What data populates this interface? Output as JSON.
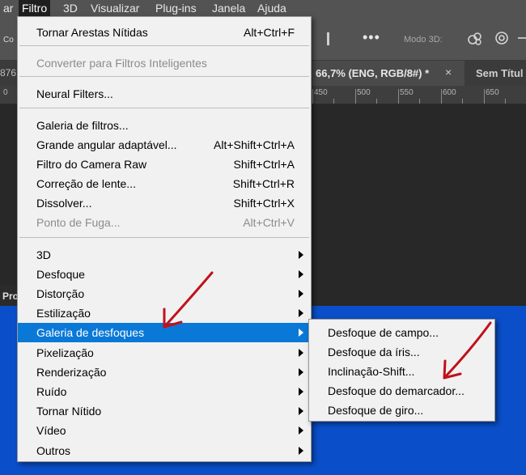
{
  "menubar": {
    "items": [
      {
        "label": "ar"
      },
      {
        "label": "Filtro"
      },
      {
        "label": "3D"
      },
      {
        "label": "Visualizar"
      },
      {
        "label": "Plug-ins"
      },
      {
        "label": "Janela"
      },
      {
        "label": "Ajuda"
      }
    ],
    "active_index": 1
  },
  "options_bar": {
    "left_label": "Co",
    "more_label": "•••",
    "mode3d_label": "Modo 3D:"
  },
  "tabs": {
    "left_number": "876",
    "active": {
      "label": "66,7% (ENG, RGB/8#) *",
      "close": "×"
    },
    "other": {
      "label": "Sem Títul"
    }
  },
  "ruler": {
    "labels": [
      "0",
      "450",
      "500",
      "550",
      "600",
      "650"
    ]
  },
  "panel": {
    "left_label": "Pro"
  },
  "filter_menu": {
    "items": [
      {
        "label": "Tornar Arestas Nítidas",
        "shortcut": "Alt+Ctrl+F",
        "disabled": false
      },
      {
        "label": "Converter para Filtros Inteligentes",
        "shortcut": "",
        "disabled": true
      },
      {
        "label": "Neural Filters...",
        "shortcut": "",
        "disabled": false
      },
      {
        "label": "Galeria de filtros...",
        "shortcut": "",
        "disabled": false
      },
      {
        "label": "Grande angular adaptável...",
        "shortcut": "Alt+Shift+Ctrl+A",
        "disabled": false
      },
      {
        "label": "Filtro do Camera Raw",
        "shortcut": "Shift+Ctrl+A",
        "disabled": false
      },
      {
        "label": "Correção de lente...",
        "shortcut": "Shift+Ctrl+R",
        "disabled": false
      },
      {
        "label": "Dissolver...",
        "shortcut": "Shift+Ctrl+X",
        "disabled": false
      },
      {
        "label": "Ponto de Fuga...",
        "shortcut": "Alt+Ctrl+V",
        "disabled": true
      },
      {
        "label": "3D",
        "submenu": true
      },
      {
        "label": "Desfoque",
        "submenu": true
      },
      {
        "label": "Distorção",
        "submenu": true
      },
      {
        "label": "Estilização",
        "submenu": true
      },
      {
        "label": "Galeria de desfoques",
        "submenu": true,
        "highlighted": true
      },
      {
        "label": "Pixelização",
        "submenu": true
      },
      {
        "label": "Renderização",
        "submenu": true
      },
      {
        "label": "Ruído",
        "submenu": true
      },
      {
        "label": "Tornar Nítido",
        "submenu": true
      },
      {
        "label": "Vídeo",
        "submenu": true
      },
      {
        "label": "Outros",
        "submenu": true
      }
    ]
  },
  "blur_gallery_submenu": {
    "items": [
      {
        "label": "Desfoque de campo..."
      },
      {
        "label": "Desfoque da íris..."
      },
      {
        "label": "Inclinação-Shift..."
      },
      {
        "label": "Desfoque do demarcador..."
      },
      {
        "label": "Desfoque de giro..."
      }
    ]
  },
  "colors": {
    "menu_bg": "#f1f1f1",
    "highlight": "#0a78d7",
    "canvas_blue": "#0a4fc9",
    "annotation_arrow": "#c0121a"
  },
  "icons": [
    "align-bar-icon",
    "more-icon",
    "orbit-3d-icon",
    "rotate-3d-icon",
    "pan-3d-icon",
    "chevron-right-icon",
    "annotation-arrow-icon"
  ]
}
